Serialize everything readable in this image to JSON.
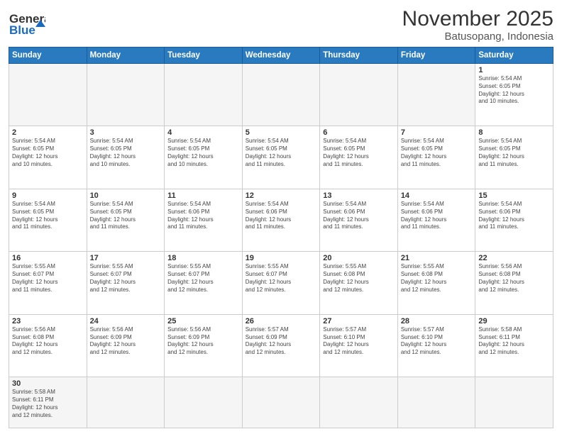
{
  "header": {
    "logo_general": "General",
    "logo_blue": "Blue",
    "month_title": "November 2025",
    "location": "Batusopang, Indonesia"
  },
  "days_of_week": [
    "Sunday",
    "Monday",
    "Tuesday",
    "Wednesday",
    "Thursday",
    "Friday",
    "Saturday"
  ],
  "weeks": [
    [
      {
        "day": "",
        "info": ""
      },
      {
        "day": "",
        "info": ""
      },
      {
        "day": "",
        "info": ""
      },
      {
        "day": "",
        "info": ""
      },
      {
        "day": "",
        "info": ""
      },
      {
        "day": "",
        "info": ""
      },
      {
        "day": "1",
        "info": "Sunrise: 5:54 AM\nSunset: 6:05 PM\nDaylight: 12 hours\nand 10 minutes."
      }
    ],
    [
      {
        "day": "2",
        "info": "Sunrise: 5:54 AM\nSunset: 6:05 PM\nDaylight: 12 hours\nand 10 minutes."
      },
      {
        "day": "3",
        "info": "Sunrise: 5:54 AM\nSunset: 6:05 PM\nDaylight: 12 hours\nand 10 minutes."
      },
      {
        "day": "4",
        "info": "Sunrise: 5:54 AM\nSunset: 6:05 PM\nDaylight: 12 hours\nand 10 minutes."
      },
      {
        "day": "5",
        "info": "Sunrise: 5:54 AM\nSunset: 6:05 PM\nDaylight: 12 hours\nand 11 minutes."
      },
      {
        "day": "6",
        "info": "Sunrise: 5:54 AM\nSunset: 6:05 PM\nDaylight: 12 hours\nand 11 minutes."
      },
      {
        "day": "7",
        "info": "Sunrise: 5:54 AM\nSunset: 6:05 PM\nDaylight: 12 hours\nand 11 minutes."
      },
      {
        "day": "8",
        "info": "Sunrise: 5:54 AM\nSunset: 6:05 PM\nDaylight: 12 hours\nand 11 minutes."
      }
    ],
    [
      {
        "day": "9",
        "info": "Sunrise: 5:54 AM\nSunset: 6:05 PM\nDaylight: 12 hours\nand 11 minutes."
      },
      {
        "day": "10",
        "info": "Sunrise: 5:54 AM\nSunset: 6:05 PM\nDaylight: 12 hours\nand 11 minutes."
      },
      {
        "day": "11",
        "info": "Sunrise: 5:54 AM\nSunset: 6:06 PM\nDaylight: 12 hours\nand 11 minutes."
      },
      {
        "day": "12",
        "info": "Sunrise: 5:54 AM\nSunset: 6:06 PM\nDaylight: 12 hours\nand 11 minutes."
      },
      {
        "day": "13",
        "info": "Sunrise: 5:54 AM\nSunset: 6:06 PM\nDaylight: 12 hours\nand 11 minutes."
      },
      {
        "day": "14",
        "info": "Sunrise: 5:54 AM\nSunset: 6:06 PM\nDaylight: 12 hours\nand 11 minutes."
      },
      {
        "day": "15",
        "info": "Sunrise: 5:54 AM\nSunset: 6:06 PM\nDaylight: 12 hours\nand 11 minutes."
      }
    ],
    [
      {
        "day": "16",
        "info": "Sunrise: 5:55 AM\nSunset: 6:07 PM\nDaylight: 12 hours\nand 11 minutes."
      },
      {
        "day": "17",
        "info": "Sunrise: 5:55 AM\nSunset: 6:07 PM\nDaylight: 12 hours\nand 12 minutes."
      },
      {
        "day": "18",
        "info": "Sunrise: 5:55 AM\nSunset: 6:07 PM\nDaylight: 12 hours\nand 12 minutes."
      },
      {
        "day": "19",
        "info": "Sunrise: 5:55 AM\nSunset: 6:07 PM\nDaylight: 12 hours\nand 12 minutes."
      },
      {
        "day": "20",
        "info": "Sunrise: 5:55 AM\nSunset: 6:08 PM\nDaylight: 12 hours\nand 12 minutes."
      },
      {
        "day": "21",
        "info": "Sunrise: 5:55 AM\nSunset: 6:08 PM\nDaylight: 12 hours\nand 12 minutes."
      },
      {
        "day": "22",
        "info": "Sunrise: 5:56 AM\nSunset: 6:08 PM\nDaylight: 12 hours\nand 12 minutes."
      }
    ],
    [
      {
        "day": "23",
        "info": "Sunrise: 5:56 AM\nSunset: 6:08 PM\nDaylight: 12 hours\nand 12 minutes."
      },
      {
        "day": "24",
        "info": "Sunrise: 5:56 AM\nSunset: 6:09 PM\nDaylight: 12 hours\nand 12 minutes."
      },
      {
        "day": "25",
        "info": "Sunrise: 5:56 AM\nSunset: 6:09 PM\nDaylight: 12 hours\nand 12 minutes."
      },
      {
        "day": "26",
        "info": "Sunrise: 5:57 AM\nSunset: 6:09 PM\nDaylight: 12 hours\nand 12 minutes."
      },
      {
        "day": "27",
        "info": "Sunrise: 5:57 AM\nSunset: 6:10 PM\nDaylight: 12 hours\nand 12 minutes."
      },
      {
        "day": "28",
        "info": "Sunrise: 5:57 AM\nSunset: 6:10 PM\nDaylight: 12 hours\nand 12 minutes."
      },
      {
        "day": "29",
        "info": "Sunrise: 5:58 AM\nSunset: 6:11 PM\nDaylight: 12 hours\nand 12 minutes."
      }
    ],
    [
      {
        "day": "30",
        "info": "Sunrise: 5:58 AM\nSunset: 6:11 PM\nDaylight: 12 hours\nand 12 minutes."
      },
      {
        "day": "",
        "info": ""
      },
      {
        "day": "",
        "info": ""
      },
      {
        "day": "",
        "info": ""
      },
      {
        "day": "",
        "info": ""
      },
      {
        "day": "",
        "info": ""
      },
      {
        "day": "",
        "info": ""
      }
    ]
  ]
}
